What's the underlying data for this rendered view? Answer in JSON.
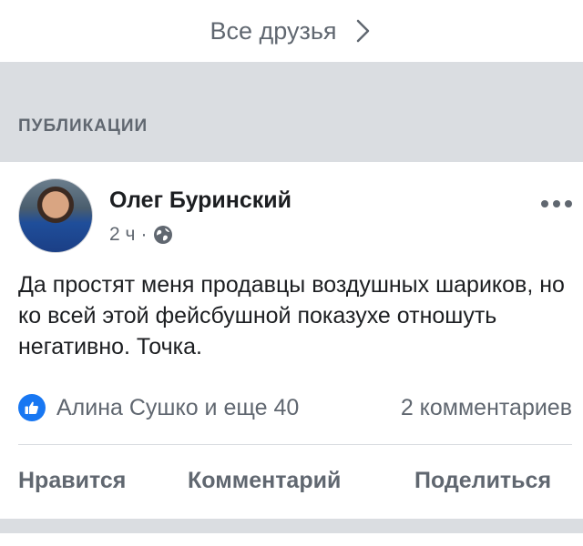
{
  "friends_link": {
    "label": "Все друзья",
    "icon": "chevron-right-icon"
  },
  "section": {
    "title": "ПУБЛИКАЦИИ"
  },
  "post": {
    "author": "Олег Буринский",
    "time": "2 ч",
    "separator": "·",
    "privacy_icon": "globe-icon",
    "more_icon": "more-icon",
    "text": "Да простят меня продавцы воздушных шариков, но ко всей этой фейсбушной показухе отношуть негативно. Точка.",
    "reactions": {
      "icon": "like-icon",
      "names": "Алина Сушко и еще 40",
      "comments": "2 комментариев"
    },
    "actions": {
      "like": "Нравится",
      "comment": "Комментарий",
      "share": "Поделиться"
    }
  },
  "colors": {
    "accent": "#1877f2",
    "secondary_text": "#606770",
    "band": "#dadde1"
  }
}
